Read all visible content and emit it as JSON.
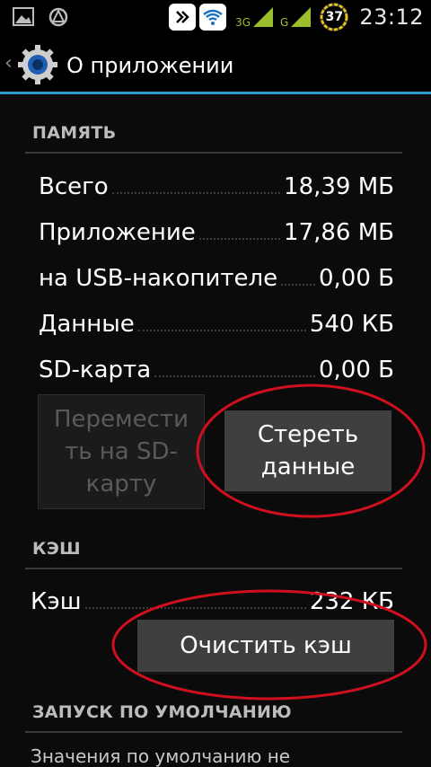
{
  "status_bar": {
    "icons_left": [
      "image-icon",
      "sync-icon"
    ],
    "icons_right": [
      "rotate-icon",
      "wifi-icon",
      "signal-3g-icon",
      "signal-g-icon"
    ],
    "net_3g": "3G",
    "net_g": "G",
    "battery": "37",
    "time": "23:12",
    "accent": "#9bbd2e"
  },
  "action_bar": {
    "title": "О приложении",
    "accent": "#2a9bd1"
  },
  "memory": {
    "title": "ПАМЯТЬ",
    "rows": [
      {
        "label": "Всего",
        "value": "18,39 МБ"
      },
      {
        "label": "Приложение",
        "value": "17,86 МБ"
      },
      {
        "label": "на USB-накопителе",
        "value": "0,00 Б"
      },
      {
        "label": "Данные",
        "value": "540 КБ"
      },
      {
        "label": "SD-карта",
        "value": "0,00 Б"
      }
    ],
    "move_button": {
      "line1": "Перемести",
      "line2": "ть на SD-",
      "line3": "карту"
    },
    "clear_data_button": {
      "line1": "Стереть",
      "line2": "данные"
    }
  },
  "cache": {
    "title": "КЭШ",
    "row": {
      "label": "Кэш",
      "value": "232 КБ"
    },
    "clear_cache_button": "Очистить кэш"
  },
  "defaults": {
    "title": "ЗАПУСК ПО УМОЛЧАНИЮ",
    "text": "Значения по умолчанию не"
  },
  "annotation_color": "#d0101e"
}
